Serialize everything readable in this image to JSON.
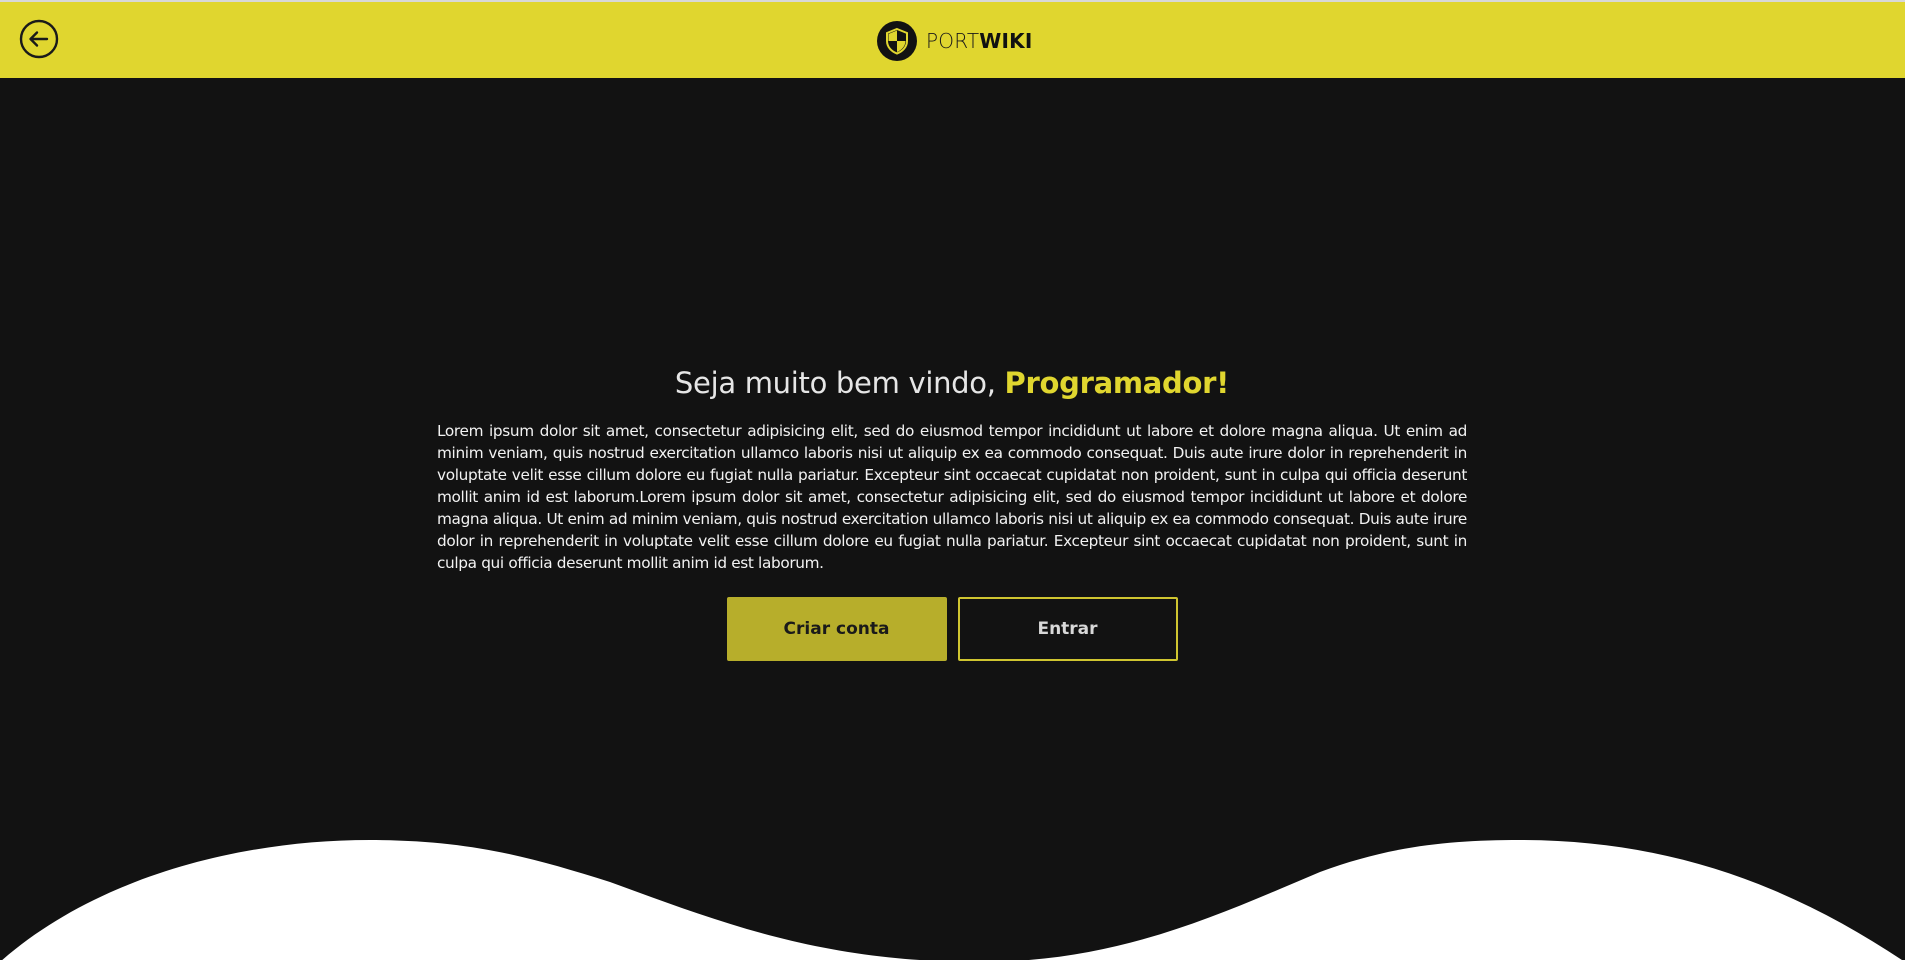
{
  "header": {
    "back_icon": "arrow-left-circle-icon",
    "brand_prefix": "PORT",
    "brand_suffix": "WIKI",
    "logo_icon": "shield-icon"
  },
  "welcome": {
    "greeting": "Seja muito bem vindo, ",
    "highlight": "Programador!",
    "body": "Lorem ipsum dolor sit amet, consectetur adipisicing elit, sed do eiusmod tempor incididunt ut labore et dolore magna aliqua. Ut enim ad minim veniam, quis nostrud exercitation ullamco laboris nisi ut aliquip ex ea commodo consequat. Duis aute irure dolor in reprehenderit in voluptate velit esse cillum dolore eu fugiat nulla pariatur. Excepteur sint occaecat cupidatat non proident, sunt in culpa qui officia deserunt mollit anim id est laborum.Lorem ipsum dolor sit amet, consectetur adipisicing elit, sed do eiusmod tempor incididunt ut labore et dolore magna aliqua. Ut enim ad minim veniam, quis nostrud exercitation ullamco laboris nisi ut aliquip ex ea commodo consequat. Duis aute irure dolor in reprehenderit in voluptate velit esse cillum dolore eu fugiat nulla pariatur. Excepteur sint occaecat cupidatat non proident, sunt in culpa qui officia deserunt mollit anim id est laborum."
  },
  "actions": {
    "create_account_label": "Criar conta",
    "login_label": "Entrar"
  },
  "colors": {
    "accent": "#e0d62f",
    "background": "#121212",
    "button_primary": "#b7ae2b",
    "wave": "#ffffff"
  }
}
